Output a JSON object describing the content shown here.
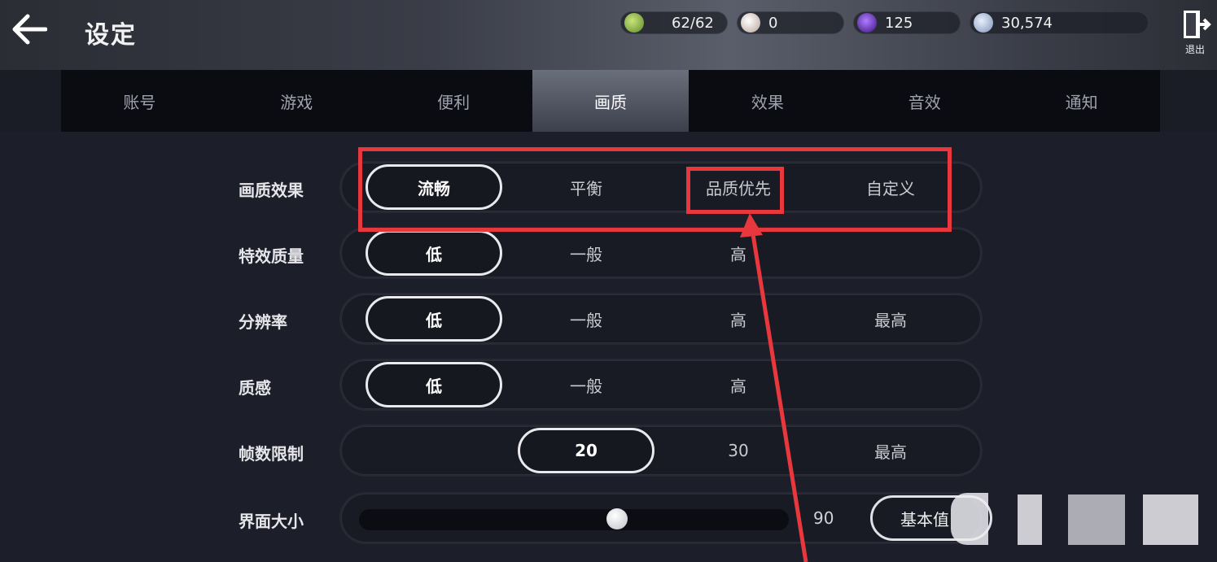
{
  "header": {
    "title": "设定",
    "exit_label": "退出",
    "resources": [
      {
        "icon": "stamina-icon",
        "value": "62/62",
        "color": "#8bbf4a"
      },
      {
        "icon": "pearl-icon",
        "value": "0",
        "color": "#d9c6be"
      },
      {
        "icon": "purple-crystal-icon",
        "value": "125",
        "color": "#6a2fd0"
      },
      {
        "icon": "silver-coin-icon",
        "value": "30,574",
        "color": "#9fb4d6"
      }
    ]
  },
  "tabs": [
    {
      "label": "账号",
      "active": false
    },
    {
      "label": "游戏",
      "active": false
    },
    {
      "label": "便利",
      "active": false
    },
    {
      "label": "画质",
      "active": true
    },
    {
      "label": "效果",
      "active": false
    },
    {
      "label": "音效",
      "active": false
    },
    {
      "label": "通知",
      "active": false
    }
  ],
  "settings": {
    "quality_preset": {
      "label": "画质效果",
      "options": [
        "流畅",
        "平衡",
        "品质优先",
        "自定义"
      ],
      "selected": "流畅"
    },
    "effect_quality": {
      "label": "特效质量",
      "options": [
        "低",
        "一般",
        "高"
      ],
      "selected": "低"
    },
    "resolution": {
      "label": "分辨率",
      "options": [
        "低",
        "一般",
        "高",
        "最高"
      ],
      "selected": "低"
    },
    "texture": {
      "label": "质感",
      "options": [
        "低",
        "一般",
        "高"
      ],
      "selected": "低"
    },
    "frame_limit": {
      "label": "帧数限制",
      "options": [
        "20",
        "30",
        "最高"
      ],
      "selected": "20"
    },
    "ui_size": {
      "label": "界面大小",
      "value": "90",
      "level": 0.6,
      "reset_label": "基本值"
    }
  },
  "colors": {
    "accent_red": "#e8383d",
    "tab_active": "#5a5f6c"
  }
}
